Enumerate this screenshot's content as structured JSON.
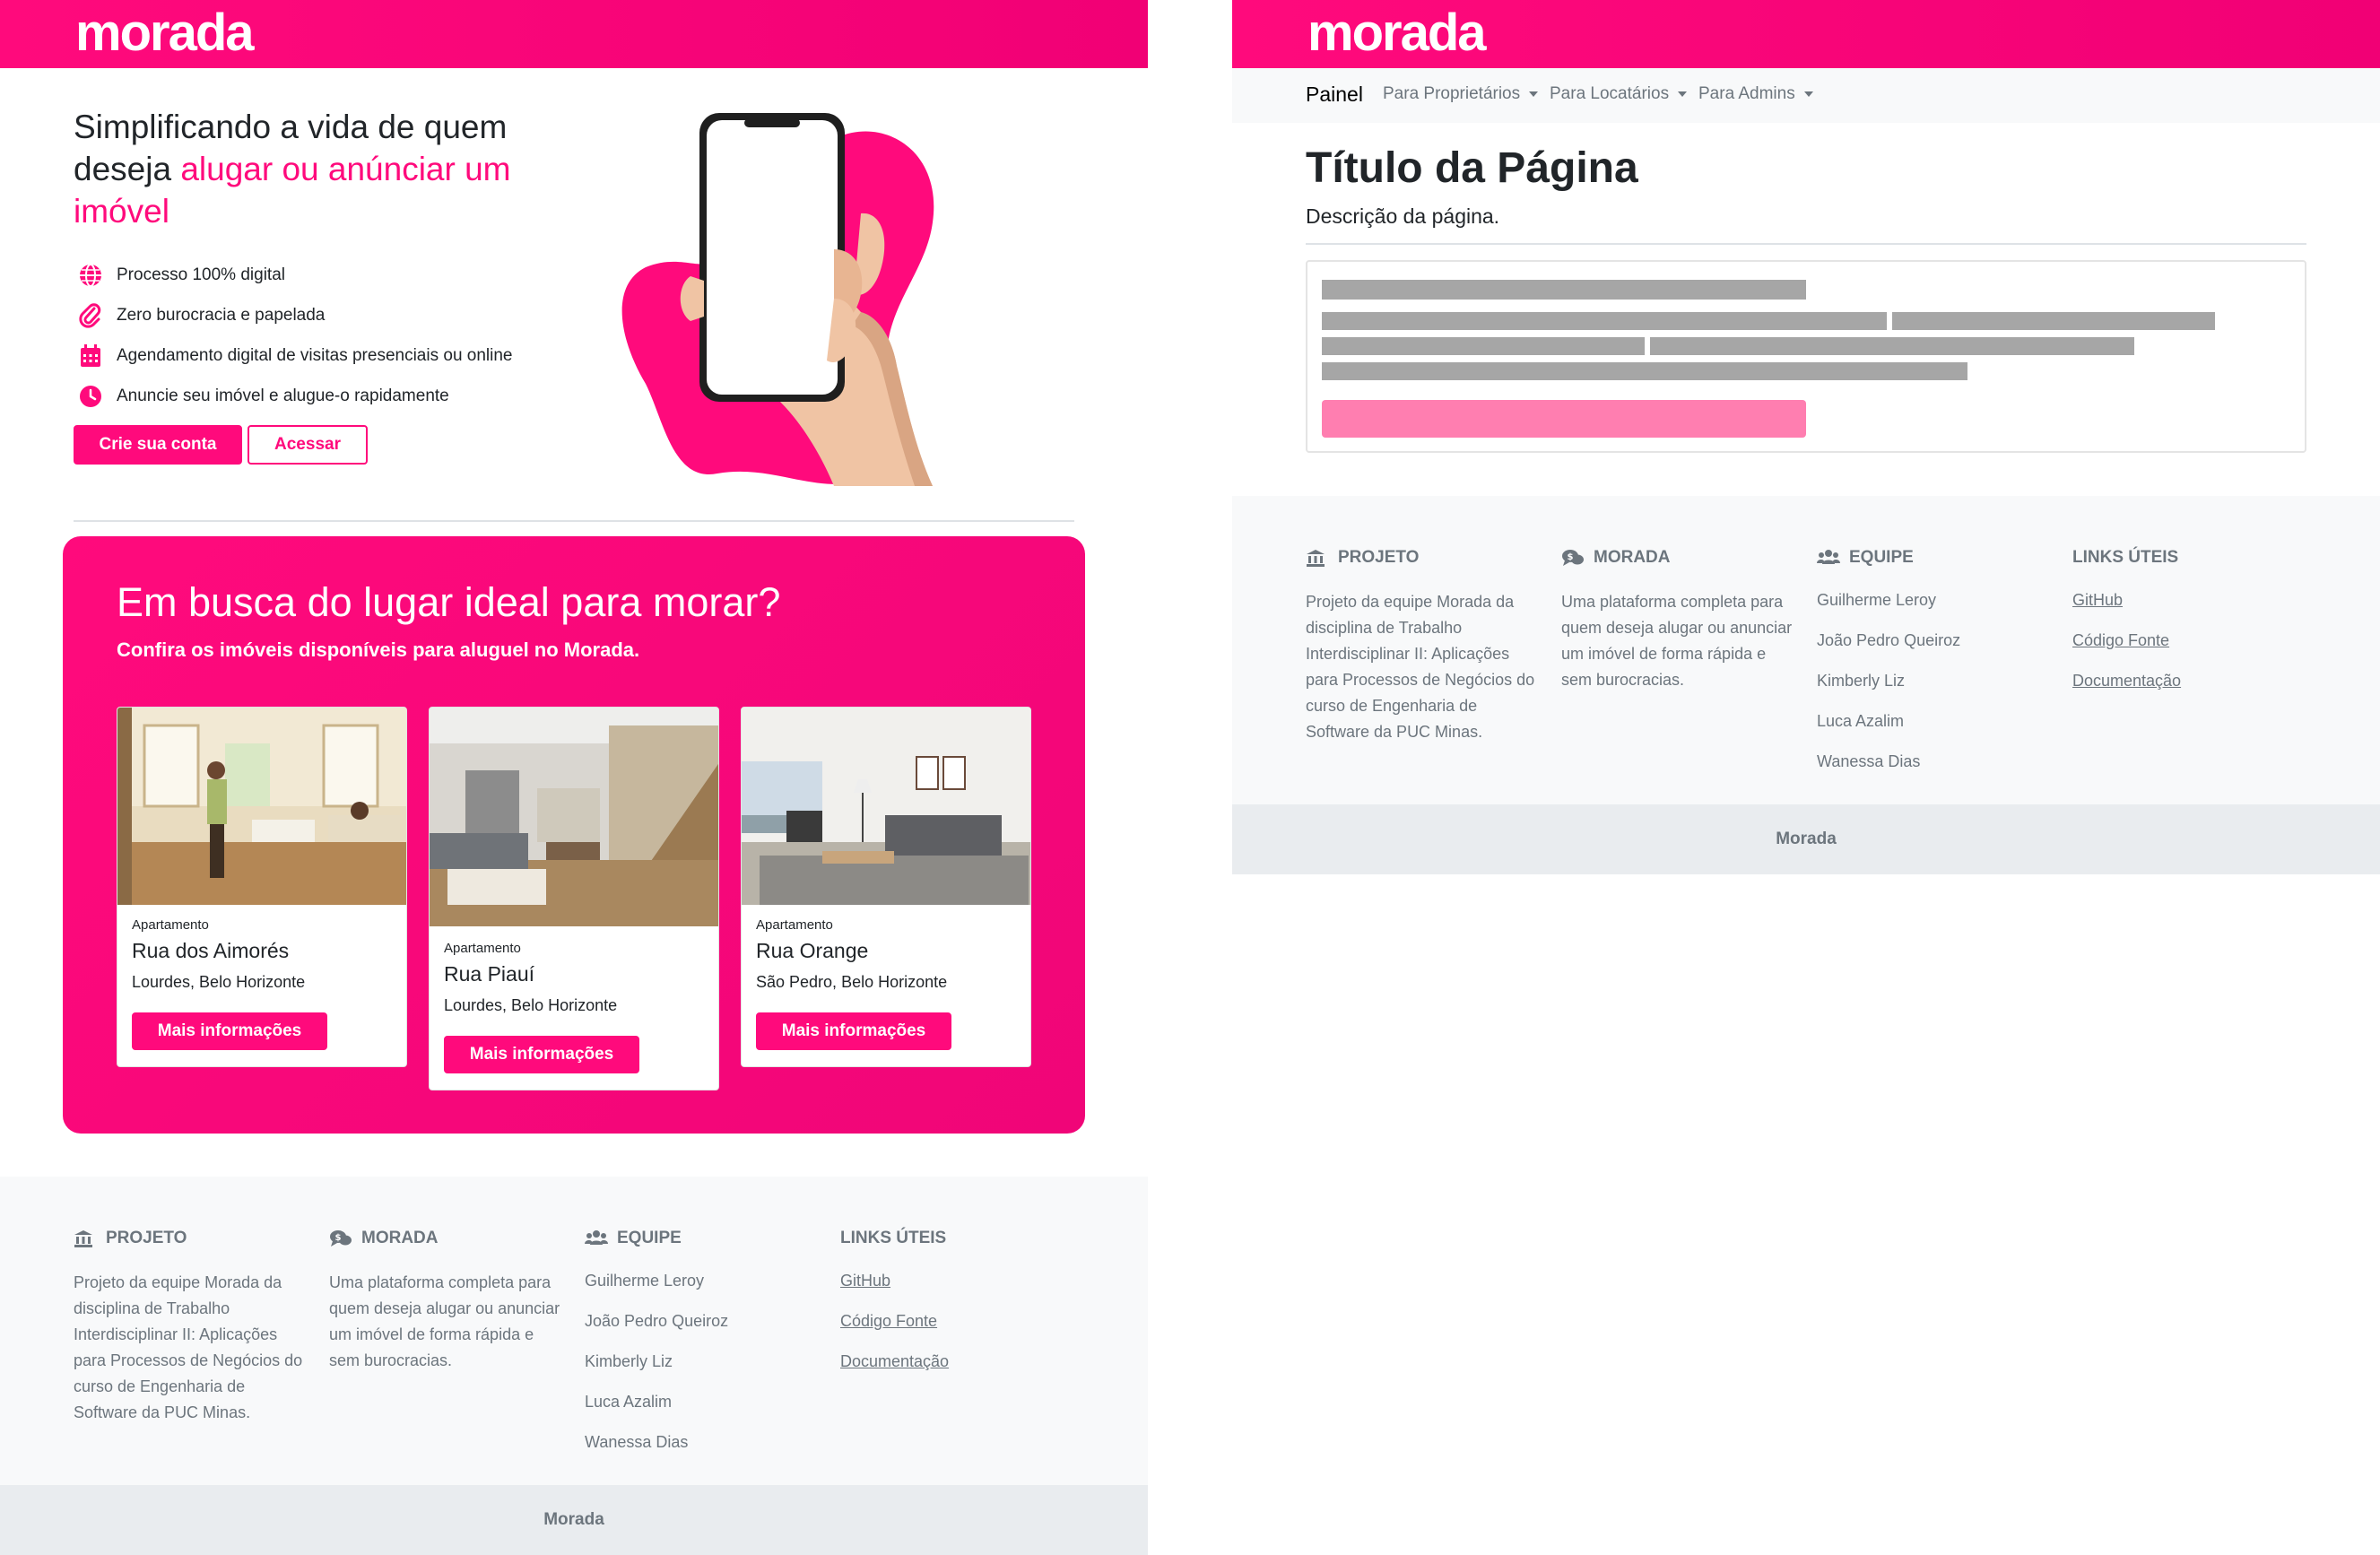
{
  "brand": {
    "name": "morada",
    "accent": "#ff0a7c",
    "footer_bg": "#f8f9fa",
    "footer_bottom_bg": "#e9ecef"
  },
  "hero": {
    "title_plain": "Simplificando a vida de quem deseja ",
    "title_accent": "alugar ou anúnciar um imóvel",
    "features": [
      {
        "icon": "globe-icon",
        "text": "Processo 100% digital"
      },
      {
        "icon": "paperclip-icon",
        "text": "Zero burocracia e papelada"
      },
      {
        "icon": "calendar-icon",
        "text": "Agendamento digital de visitas presenciais ou online"
      },
      {
        "icon": "clock-icon",
        "text": "Anuncie seu imóvel e alugue-o rapidamente"
      }
    ],
    "primary_button": "Crie sua conta",
    "secondary_button": "Acessar"
  },
  "search": {
    "title": "Em busca do lugar ideal para morar?",
    "subtitle": "Confira os imóveis disponíveis para aluguel no Morada.",
    "cards": [
      {
        "type": "Apartamento",
        "street": "Rua dos Aimorés",
        "location": "Lourdes, Belo Horizonte",
        "button": "Mais informações"
      },
      {
        "type": "Apartamento",
        "street": "Rua Piauí",
        "location": "Lourdes, Belo Horizonte",
        "button": "Mais informações"
      },
      {
        "type": "Apartamento",
        "street": "Rua Orange",
        "location": "São Pedro, Belo Horizonte",
        "button": "Mais informações"
      }
    ]
  },
  "footer": {
    "projeto": {
      "heading": "PROJETO",
      "icon": "bank-icon",
      "text": "Projeto da equipe Morada da disciplina de Trabalho Interdisciplinar II: Aplicações para Processos de Negócios do curso de Engenharia de Software da PUC Minas."
    },
    "morada": {
      "heading": "MORADA",
      "icon": "comments-dollar-icon",
      "text": "Uma plataforma completa para quem deseja alugar ou anunciar um imóvel de forma rápida e sem burocracias."
    },
    "equipe": {
      "heading": "EQUIPE",
      "icon": "users-icon",
      "members": [
        "Guilherme Leroy",
        "João Pedro Queiroz",
        "Kimberly Liz",
        "Luca Azalim",
        "Wanessa Dias"
      ]
    },
    "links": {
      "heading": "LINKS ÚTEIS",
      "items": [
        "GitHub",
        "Código Fonte",
        "Documentação"
      ]
    },
    "bottom": "Morada"
  },
  "admin": {
    "nav": {
      "active": "Painel",
      "items": [
        "Para Proprietários",
        "Para Locatários",
        "Para Admins"
      ]
    },
    "page_title": "Título da Página",
    "page_description": "Descrição da página."
  }
}
